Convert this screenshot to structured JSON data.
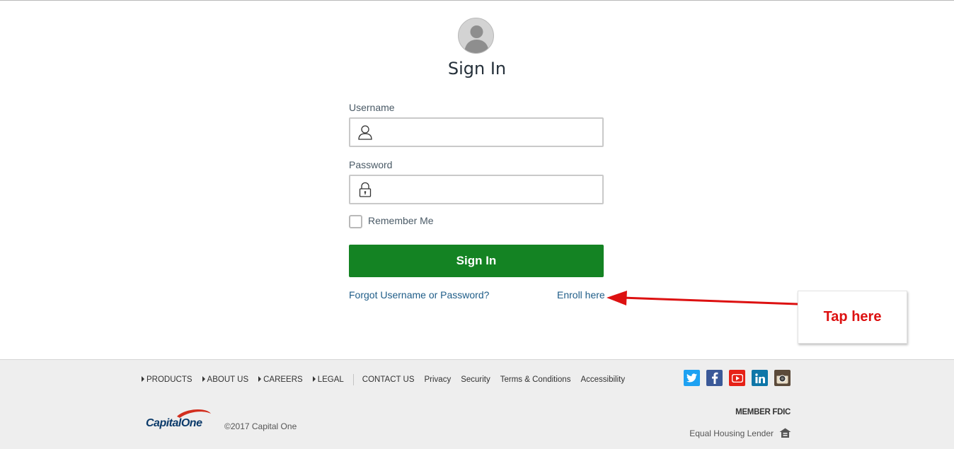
{
  "signin": {
    "title": "Sign In",
    "username_label": "Username",
    "username_value": "",
    "password_label": "Password",
    "password_value": "",
    "remember_label": "Remember Me",
    "submit_label": "Sign In",
    "forgot_link": "Forgot Username or Password?",
    "enroll_link": "Enroll here"
  },
  "annotation": {
    "callout_text": "Tap here",
    "color": "#dd1111"
  },
  "footer": {
    "nav": [
      {
        "label": "PRODUCTS",
        "arrow": true
      },
      {
        "label": "ABOUT US",
        "arrow": true
      },
      {
        "label": "CAREERS",
        "arrow": true
      },
      {
        "label": "LEGAL",
        "arrow": true
      },
      {
        "label": "CONTACT US",
        "arrow": false
      },
      {
        "label": "Privacy",
        "arrow": false
      },
      {
        "label": "Security",
        "arrow": false
      },
      {
        "label": "Terms & Conditions",
        "arrow": false
      },
      {
        "label": "Accessibility",
        "arrow": false
      }
    ],
    "social": [
      {
        "name": "twitter-icon",
        "color": "#1da1f2"
      },
      {
        "name": "facebook-icon",
        "color": "#3b5998"
      },
      {
        "name": "youtube-icon",
        "color": "#e62117"
      },
      {
        "name": "linkedin-icon",
        "color": "#0e76a8"
      },
      {
        "name": "instagram-icon",
        "color": "#5b4a3a"
      }
    ],
    "logo_text": "CapitalOne",
    "copyright": "©2017 Capital One",
    "fdic": "MEMBER FDIC",
    "equal_housing": "Equal Housing Lender"
  },
  "colors": {
    "button_green": "#148323",
    "link_blue": "#1f5d88"
  }
}
